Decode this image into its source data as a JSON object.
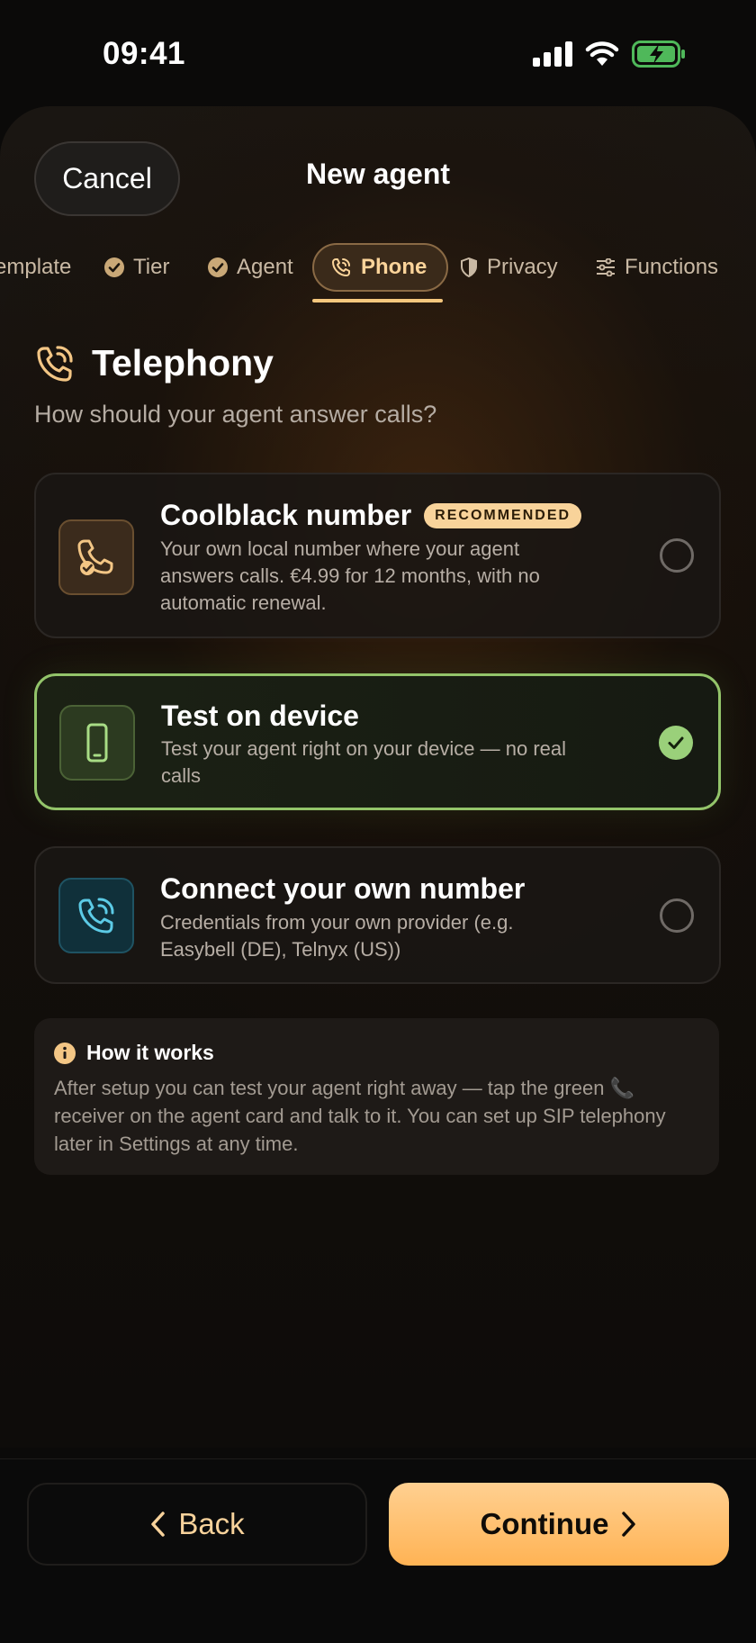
{
  "status_bar": {
    "time": "09:41"
  },
  "header": {
    "cancel_label": "Cancel",
    "title": "New agent"
  },
  "steps": [
    {
      "label": "emplate",
      "state": "done"
    },
    {
      "label": "Tier",
      "state": "done"
    },
    {
      "label": "Agent",
      "state": "done"
    },
    {
      "label": "Phone",
      "state": "active"
    },
    {
      "label": "Privacy",
      "state": "pending"
    },
    {
      "label": "Functions",
      "state": "pending"
    }
  ],
  "section": {
    "title": "Telephony",
    "subtitle": "How should your agent answer calls?"
  },
  "options": [
    {
      "title": "Coolblack number",
      "badge": "RECOMMENDED",
      "description": "Your own local number where your agent answers calls. €4.99 for 12 months, with no automatic renewal.",
      "icon": "phone-check-icon",
      "selected": false
    },
    {
      "title": "Test on device",
      "description": "Test your agent right on your device — no real calls",
      "icon": "smartphone-icon",
      "selected": true
    },
    {
      "title": "Connect your own number",
      "description": "Credentials from your own provider (e.g. Easybell (DE), Telnyx (US))",
      "icon": "phone-ringing-icon",
      "selected": false
    }
  ],
  "info": {
    "title": "How it works",
    "text": "After setup you can test your agent right away — tap the green 📞 receiver on the agent card and talk to it. You can set up SIP telephony later in Settings at any time."
  },
  "footer": {
    "back_label": "Back",
    "continue_label": "Continue"
  },
  "colors": {
    "accent": "#f5c77d",
    "selected_border": "#93c46a",
    "continue_bg": "#ffc26e"
  }
}
